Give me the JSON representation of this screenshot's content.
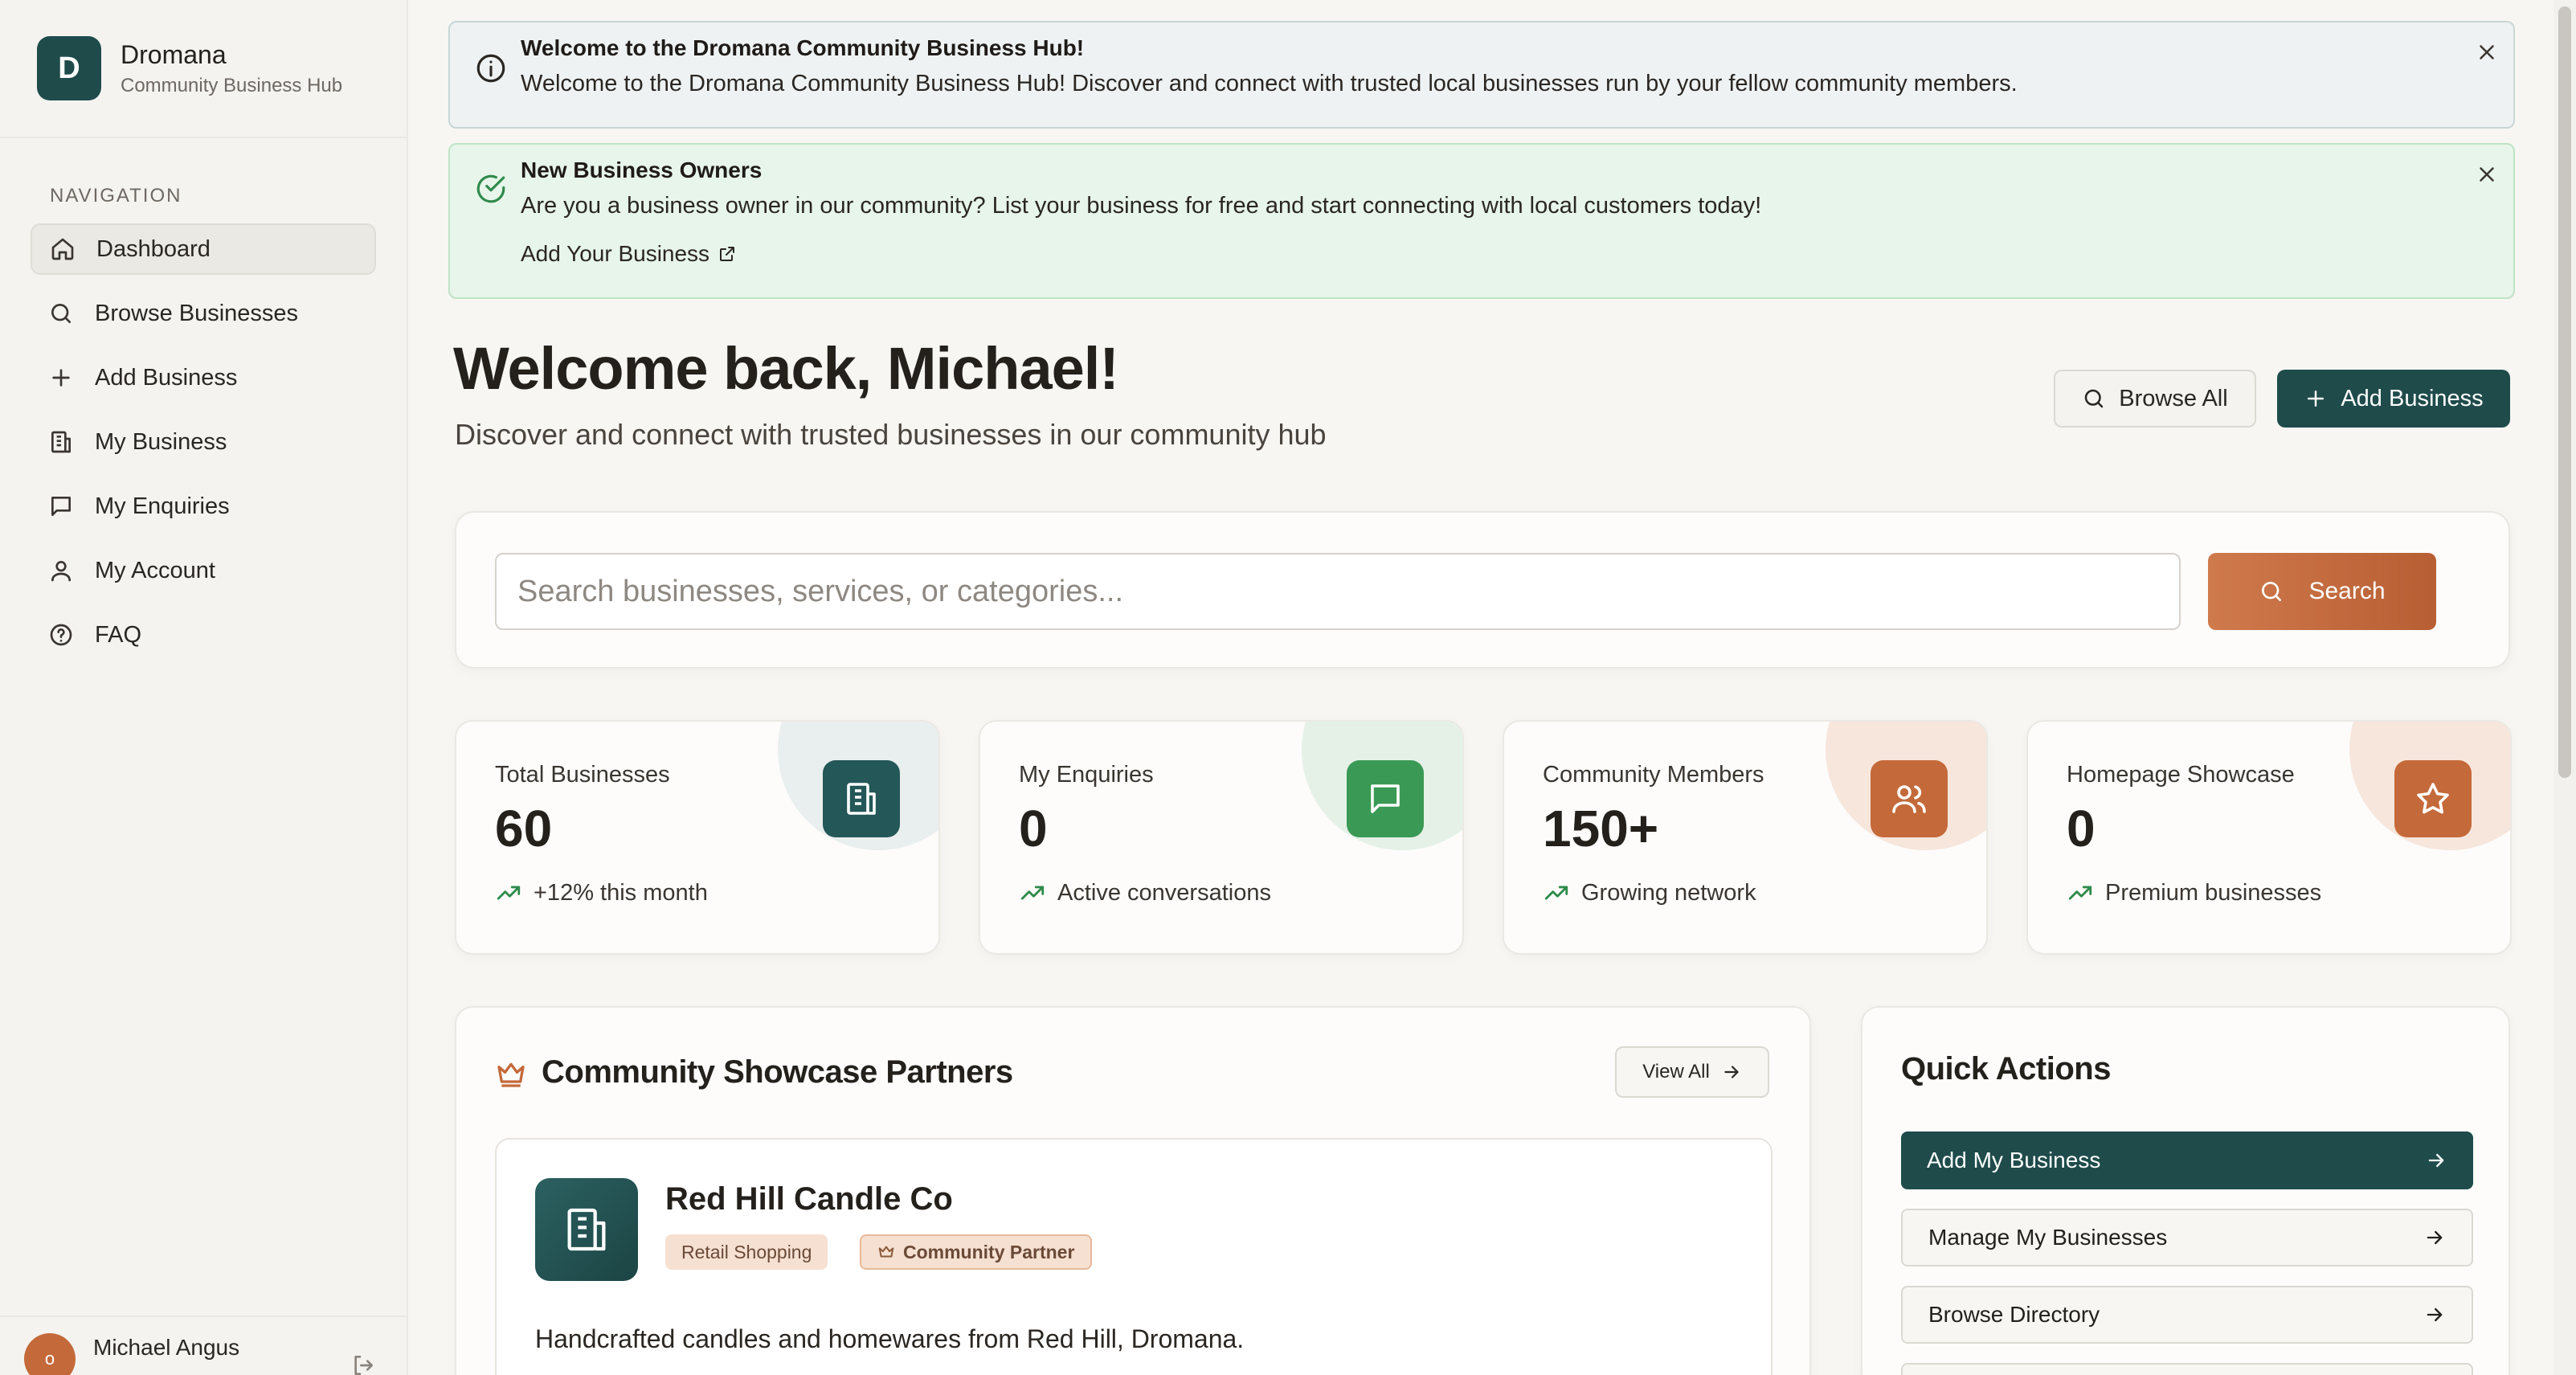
{
  "brand": {
    "initial": "D",
    "name": "Dromana",
    "subtitle": "Community Business Hub"
  },
  "navigation": {
    "heading": "NAVIGATION",
    "items": [
      {
        "label": "Dashboard",
        "icon": "home-icon",
        "active": true
      },
      {
        "label": "Browse Businesses",
        "icon": "search-icon"
      },
      {
        "label": "Add Business",
        "icon": "plus-icon"
      },
      {
        "label": "My Business",
        "icon": "building-icon"
      },
      {
        "label": "My Enquiries",
        "icon": "message-icon"
      },
      {
        "label": "My Account",
        "icon": "user-icon"
      },
      {
        "label": "FAQ",
        "icon": "help-circle-icon"
      }
    ]
  },
  "user": {
    "initial": "o",
    "name": "Michael Angus"
  },
  "alerts": {
    "info": {
      "title": "Welcome to the Dromana Community Business Hub!",
      "text": "Welcome to the Dromana Community Business Hub! Discover and connect with trusted local businesses run by your fellow community members."
    },
    "success": {
      "title": "New Business Owners",
      "text": "Are you a business owner in our community? List your business for free and start connecting with local customers today!",
      "link": "Add Your Business"
    }
  },
  "hero": {
    "title": "Welcome back, Michael!",
    "subtitle": "Discover and connect with trusted businesses in our community hub",
    "browse_label": "Browse All",
    "add_label": "Add Business"
  },
  "search": {
    "placeholder": "Search businesses, services, or categories...",
    "button_label": "Search"
  },
  "stats": [
    {
      "label": "Total Businesses",
      "value": "60",
      "note": "+12% this month",
      "icon": "building-icon"
    },
    {
      "label": "My Enquiries",
      "value": "0",
      "note": "Active conversations",
      "icon": "message-icon"
    },
    {
      "label": "Community Members",
      "value": "150+",
      "note": "Growing network",
      "icon": "users-icon"
    },
    {
      "label": "Homepage Showcase",
      "value": "0",
      "note": "Premium businesses",
      "icon": "star-icon"
    }
  ],
  "colors": {
    "primary": "#1f4b4b",
    "accent": "#c4693a",
    "success": "#2f8a4a"
  },
  "showcase": {
    "title": "Community Showcase Partners",
    "view_all_label": "View All",
    "business": {
      "name": "Red Hill Candle Co",
      "category": "Retail Shopping",
      "badge": "Community Partner",
      "description": "Handcrafted candles and homewares from Red Hill, Dromana."
    }
  },
  "quick_actions": {
    "title": "Quick Actions",
    "items": [
      {
        "label": "Add My Business"
      },
      {
        "label": "Manage My Businesses"
      },
      {
        "label": "Browse Directory"
      },
      {
        "label": ""
      }
    ]
  }
}
